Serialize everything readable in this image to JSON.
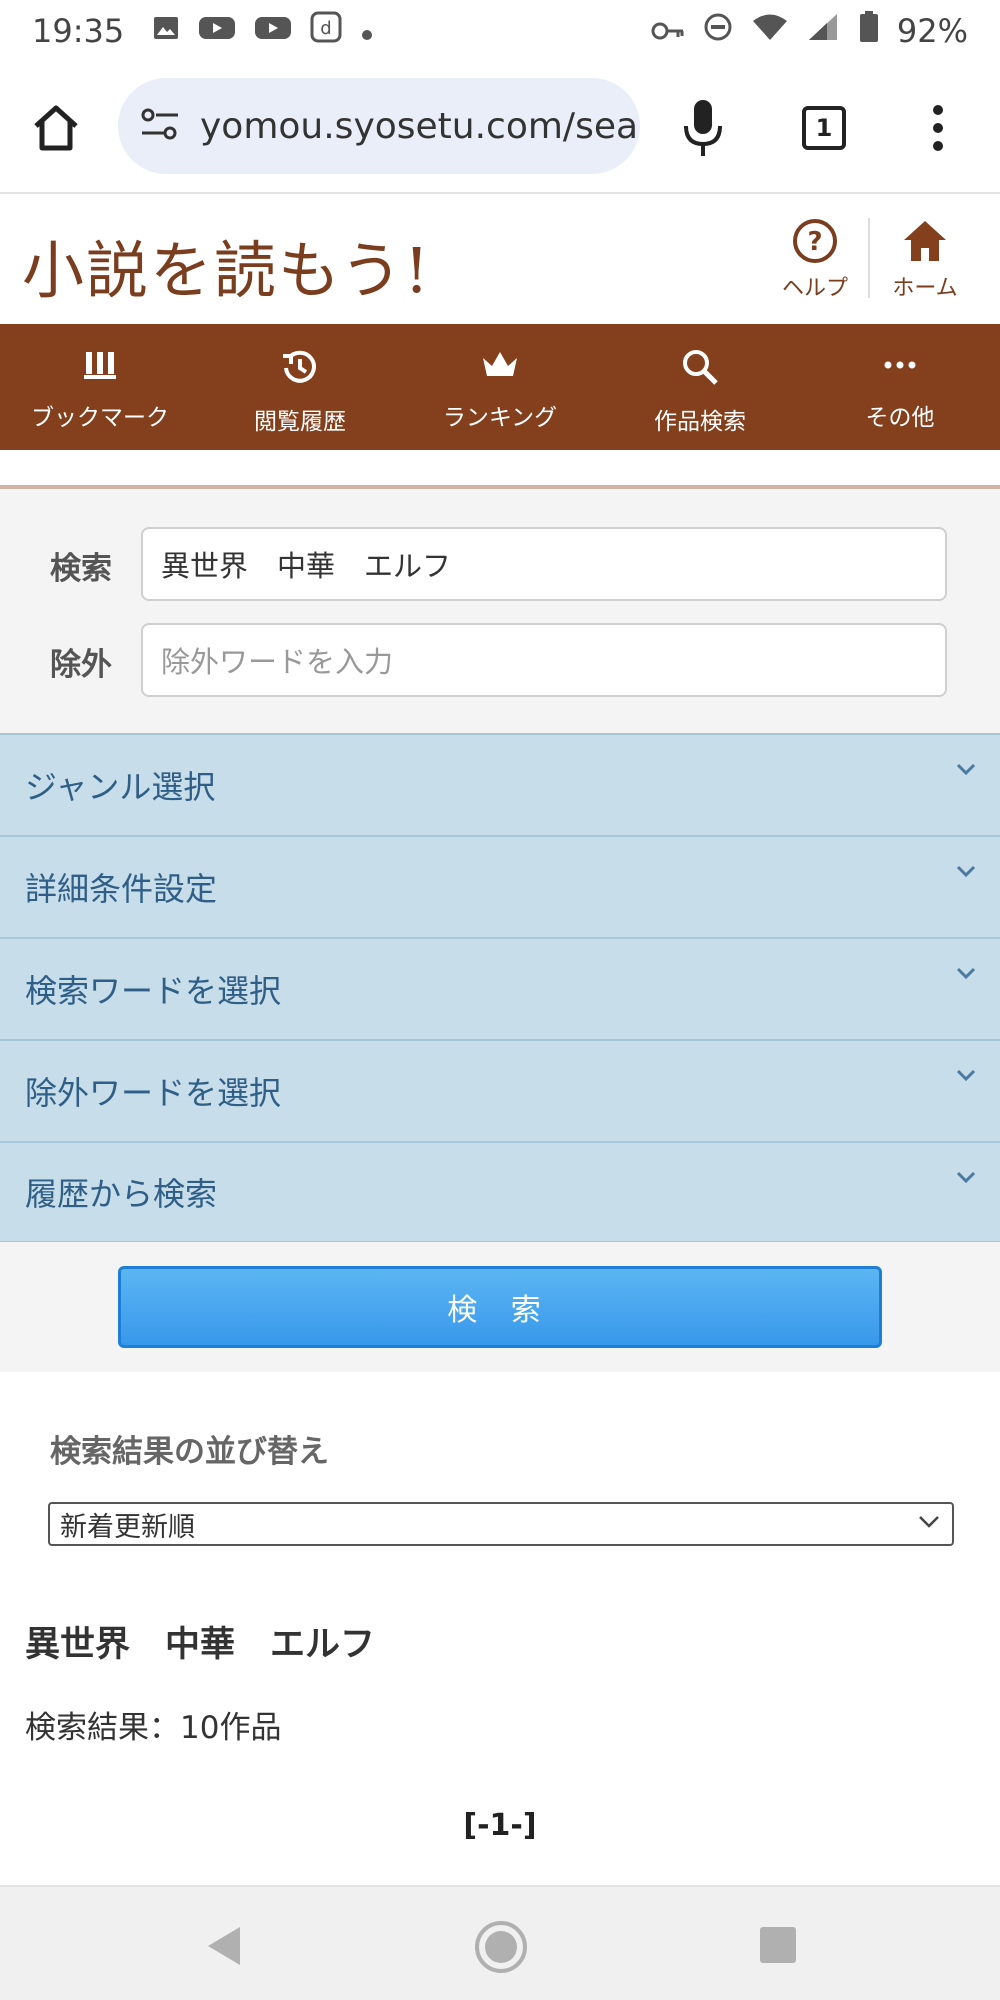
{
  "status_bar": {
    "time": "19:35",
    "battery": "92%",
    "icons": [
      "image-icon",
      "youtube-icon",
      "youtube-icon",
      "d-app-icon",
      "dot-icon",
      "vpn-key-icon",
      "dnd-icon",
      "wifi-icon",
      "signal-icon",
      "battery-icon"
    ]
  },
  "browser": {
    "url": "yomou.syosetu.com/sea",
    "tab_count": "1"
  },
  "site": {
    "logo": "小説を読もう!",
    "help_label": "ヘルプ",
    "home_label": "ホーム"
  },
  "nav": [
    {
      "label": "ブックマーク",
      "icon": "bookmark-icon"
    },
    {
      "label": "閲覧履歴",
      "icon": "history-icon"
    },
    {
      "label": "ランキング",
      "icon": "crown-icon"
    },
    {
      "label": "作品検索",
      "icon": "search-icon"
    },
    {
      "label": "その他",
      "icon": "more-icon"
    }
  ],
  "form": {
    "search_label": "検索",
    "search_value": "異世界　中華　エルフ",
    "exclude_label": "除外",
    "exclude_placeholder": "除外ワードを入力"
  },
  "accordion": [
    "ジャンル選択",
    "詳細条件設定",
    "検索ワードを選択",
    "除外ワードを選択",
    "履歴から検索"
  ],
  "search_button": "検 索",
  "results": {
    "sort_label": "検索結果の並び替え",
    "sort_value": "新着更新順",
    "query_title": "異世界　中華　エルフ",
    "count": "検索結果：10作品",
    "pager": "[-1-]"
  },
  "colors": {
    "brand": "#843f1d",
    "accordion": "#c7ddea",
    "button": "#3898eb"
  }
}
